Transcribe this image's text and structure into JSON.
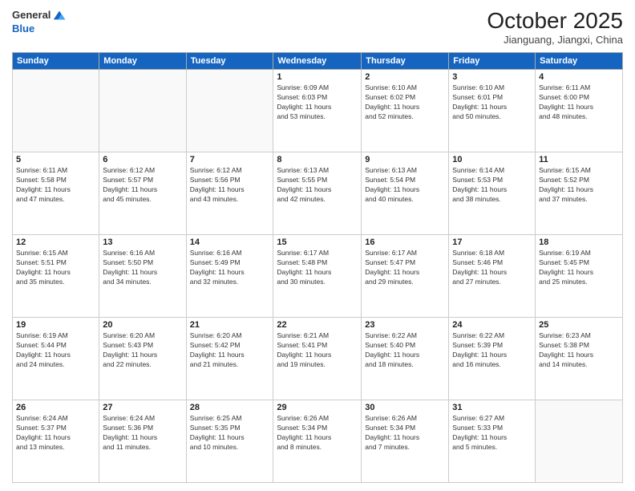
{
  "header": {
    "logo_line1": "General",
    "logo_line2": "Blue",
    "month": "October 2025",
    "location": "Jianguang, Jiangxi, China"
  },
  "weekdays": [
    "Sunday",
    "Monday",
    "Tuesday",
    "Wednesday",
    "Thursday",
    "Friday",
    "Saturday"
  ],
  "weeks": [
    [
      {
        "day": "",
        "info": ""
      },
      {
        "day": "",
        "info": ""
      },
      {
        "day": "",
        "info": ""
      },
      {
        "day": "1",
        "info": "Sunrise: 6:09 AM\nSunset: 6:03 PM\nDaylight: 11 hours\nand 53 minutes."
      },
      {
        "day": "2",
        "info": "Sunrise: 6:10 AM\nSunset: 6:02 PM\nDaylight: 11 hours\nand 52 minutes."
      },
      {
        "day": "3",
        "info": "Sunrise: 6:10 AM\nSunset: 6:01 PM\nDaylight: 11 hours\nand 50 minutes."
      },
      {
        "day": "4",
        "info": "Sunrise: 6:11 AM\nSunset: 6:00 PM\nDaylight: 11 hours\nand 48 minutes."
      }
    ],
    [
      {
        "day": "5",
        "info": "Sunrise: 6:11 AM\nSunset: 5:58 PM\nDaylight: 11 hours\nand 47 minutes."
      },
      {
        "day": "6",
        "info": "Sunrise: 6:12 AM\nSunset: 5:57 PM\nDaylight: 11 hours\nand 45 minutes."
      },
      {
        "day": "7",
        "info": "Sunrise: 6:12 AM\nSunset: 5:56 PM\nDaylight: 11 hours\nand 43 minutes."
      },
      {
        "day": "8",
        "info": "Sunrise: 6:13 AM\nSunset: 5:55 PM\nDaylight: 11 hours\nand 42 minutes."
      },
      {
        "day": "9",
        "info": "Sunrise: 6:13 AM\nSunset: 5:54 PM\nDaylight: 11 hours\nand 40 minutes."
      },
      {
        "day": "10",
        "info": "Sunrise: 6:14 AM\nSunset: 5:53 PM\nDaylight: 11 hours\nand 38 minutes."
      },
      {
        "day": "11",
        "info": "Sunrise: 6:15 AM\nSunset: 5:52 PM\nDaylight: 11 hours\nand 37 minutes."
      }
    ],
    [
      {
        "day": "12",
        "info": "Sunrise: 6:15 AM\nSunset: 5:51 PM\nDaylight: 11 hours\nand 35 minutes."
      },
      {
        "day": "13",
        "info": "Sunrise: 6:16 AM\nSunset: 5:50 PM\nDaylight: 11 hours\nand 34 minutes."
      },
      {
        "day": "14",
        "info": "Sunrise: 6:16 AM\nSunset: 5:49 PM\nDaylight: 11 hours\nand 32 minutes."
      },
      {
        "day": "15",
        "info": "Sunrise: 6:17 AM\nSunset: 5:48 PM\nDaylight: 11 hours\nand 30 minutes."
      },
      {
        "day": "16",
        "info": "Sunrise: 6:17 AM\nSunset: 5:47 PM\nDaylight: 11 hours\nand 29 minutes."
      },
      {
        "day": "17",
        "info": "Sunrise: 6:18 AM\nSunset: 5:46 PM\nDaylight: 11 hours\nand 27 minutes."
      },
      {
        "day": "18",
        "info": "Sunrise: 6:19 AM\nSunset: 5:45 PM\nDaylight: 11 hours\nand 25 minutes."
      }
    ],
    [
      {
        "day": "19",
        "info": "Sunrise: 6:19 AM\nSunset: 5:44 PM\nDaylight: 11 hours\nand 24 minutes."
      },
      {
        "day": "20",
        "info": "Sunrise: 6:20 AM\nSunset: 5:43 PM\nDaylight: 11 hours\nand 22 minutes."
      },
      {
        "day": "21",
        "info": "Sunrise: 6:20 AM\nSunset: 5:42 PM\nDaylight: 11 hours\nand 21 minutes."
      },
      {
        "day": "22",
        "info": "Sunrise: 6:21 AM\nSunset: 5:41 PM\nDaylight: 11 hours\nand 19 minutes."
      },
      {
        "day": "23",
        "info": "Sunrise: 6:22 AM\nSunset: 5:40 PM\nDaylight: 11 hours\nand 18 minutes."
      },
      {
        "day": "24",
        "info": "Sunrise: 6:22 AM\nSunset: 5:39 PM\nDaylight: 11 hours\nand 16 minutes."
      },
      {
        "day": "25",
        "info": "Sunrise: 6:23 AM\nSunset: 5:38 PM\nDaylight: 11 hours\nand 14 minutes."
      }
    ],
    [
      {
        "day": "26",
        "info": "Sunrise: 6:24 AM\nSunset: 5:37 PM\nDaylight: 11 hours\nand 13 minutes."
      },
      {
        "day": "27",
        "info": "Sunrise: 6:24 AM\nSunset: 5:36 PM\nDaylight: 11 hours\nand 11 minutes."
      },
      {
        "day": "28",
        "info": "Sunrise: 6:25 AM\nSunset: 5:35 PM\nDaylight: 11 hours\nand 10 minutes."
      },
      {
        "day": "29",
        "info": "Sunrise: 6:26 AM\nSunset: 5:34 PM\nDaylight: 11 hours\nand 8 minutes."
      },
      {
        "day": "30",
        "info": "Sunrise: 6:26 AM\nSunset: 5:34 PM\nDaylight: 11 hours\nand 7 minutes."
      },
      {
        "day": "31",
        "info": "Sunrise: 6:27 AM\nSunset: 5:33 PM\nDaylight: 11 hours\nand 5 minutes."
      },
      {
        "day": "",
        "info": ""
      }
    ]
  ]
}
